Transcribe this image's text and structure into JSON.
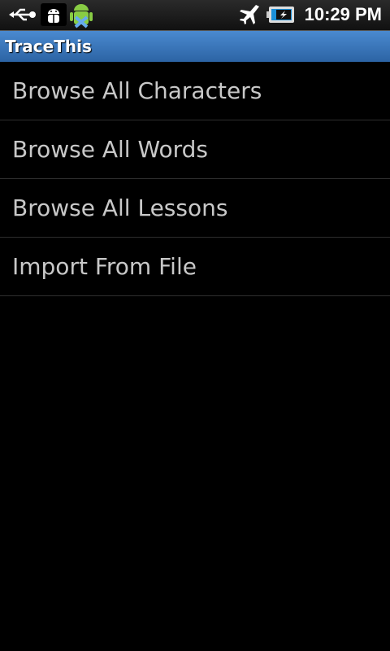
{
  "status_bar": {
    "time": "10:29 PM",
    "icons": [
      "usb-icon",
      "debug-icon",
      "app-notification-icon",
      "airplane-mode-icon",
      "battery-charging-icon"
    ]
  },
  "app": {
    "title": "TraceThis"
  },
  "menu": {
    "items": [
      {
        "label": "Browse All Characters"
      },
      {
        "label": "Browse All Words"
      },
      {
        "label": "Browse All Lessons"
      },
      {
        "label": "Import From File"
      }
    ]
  }
}
